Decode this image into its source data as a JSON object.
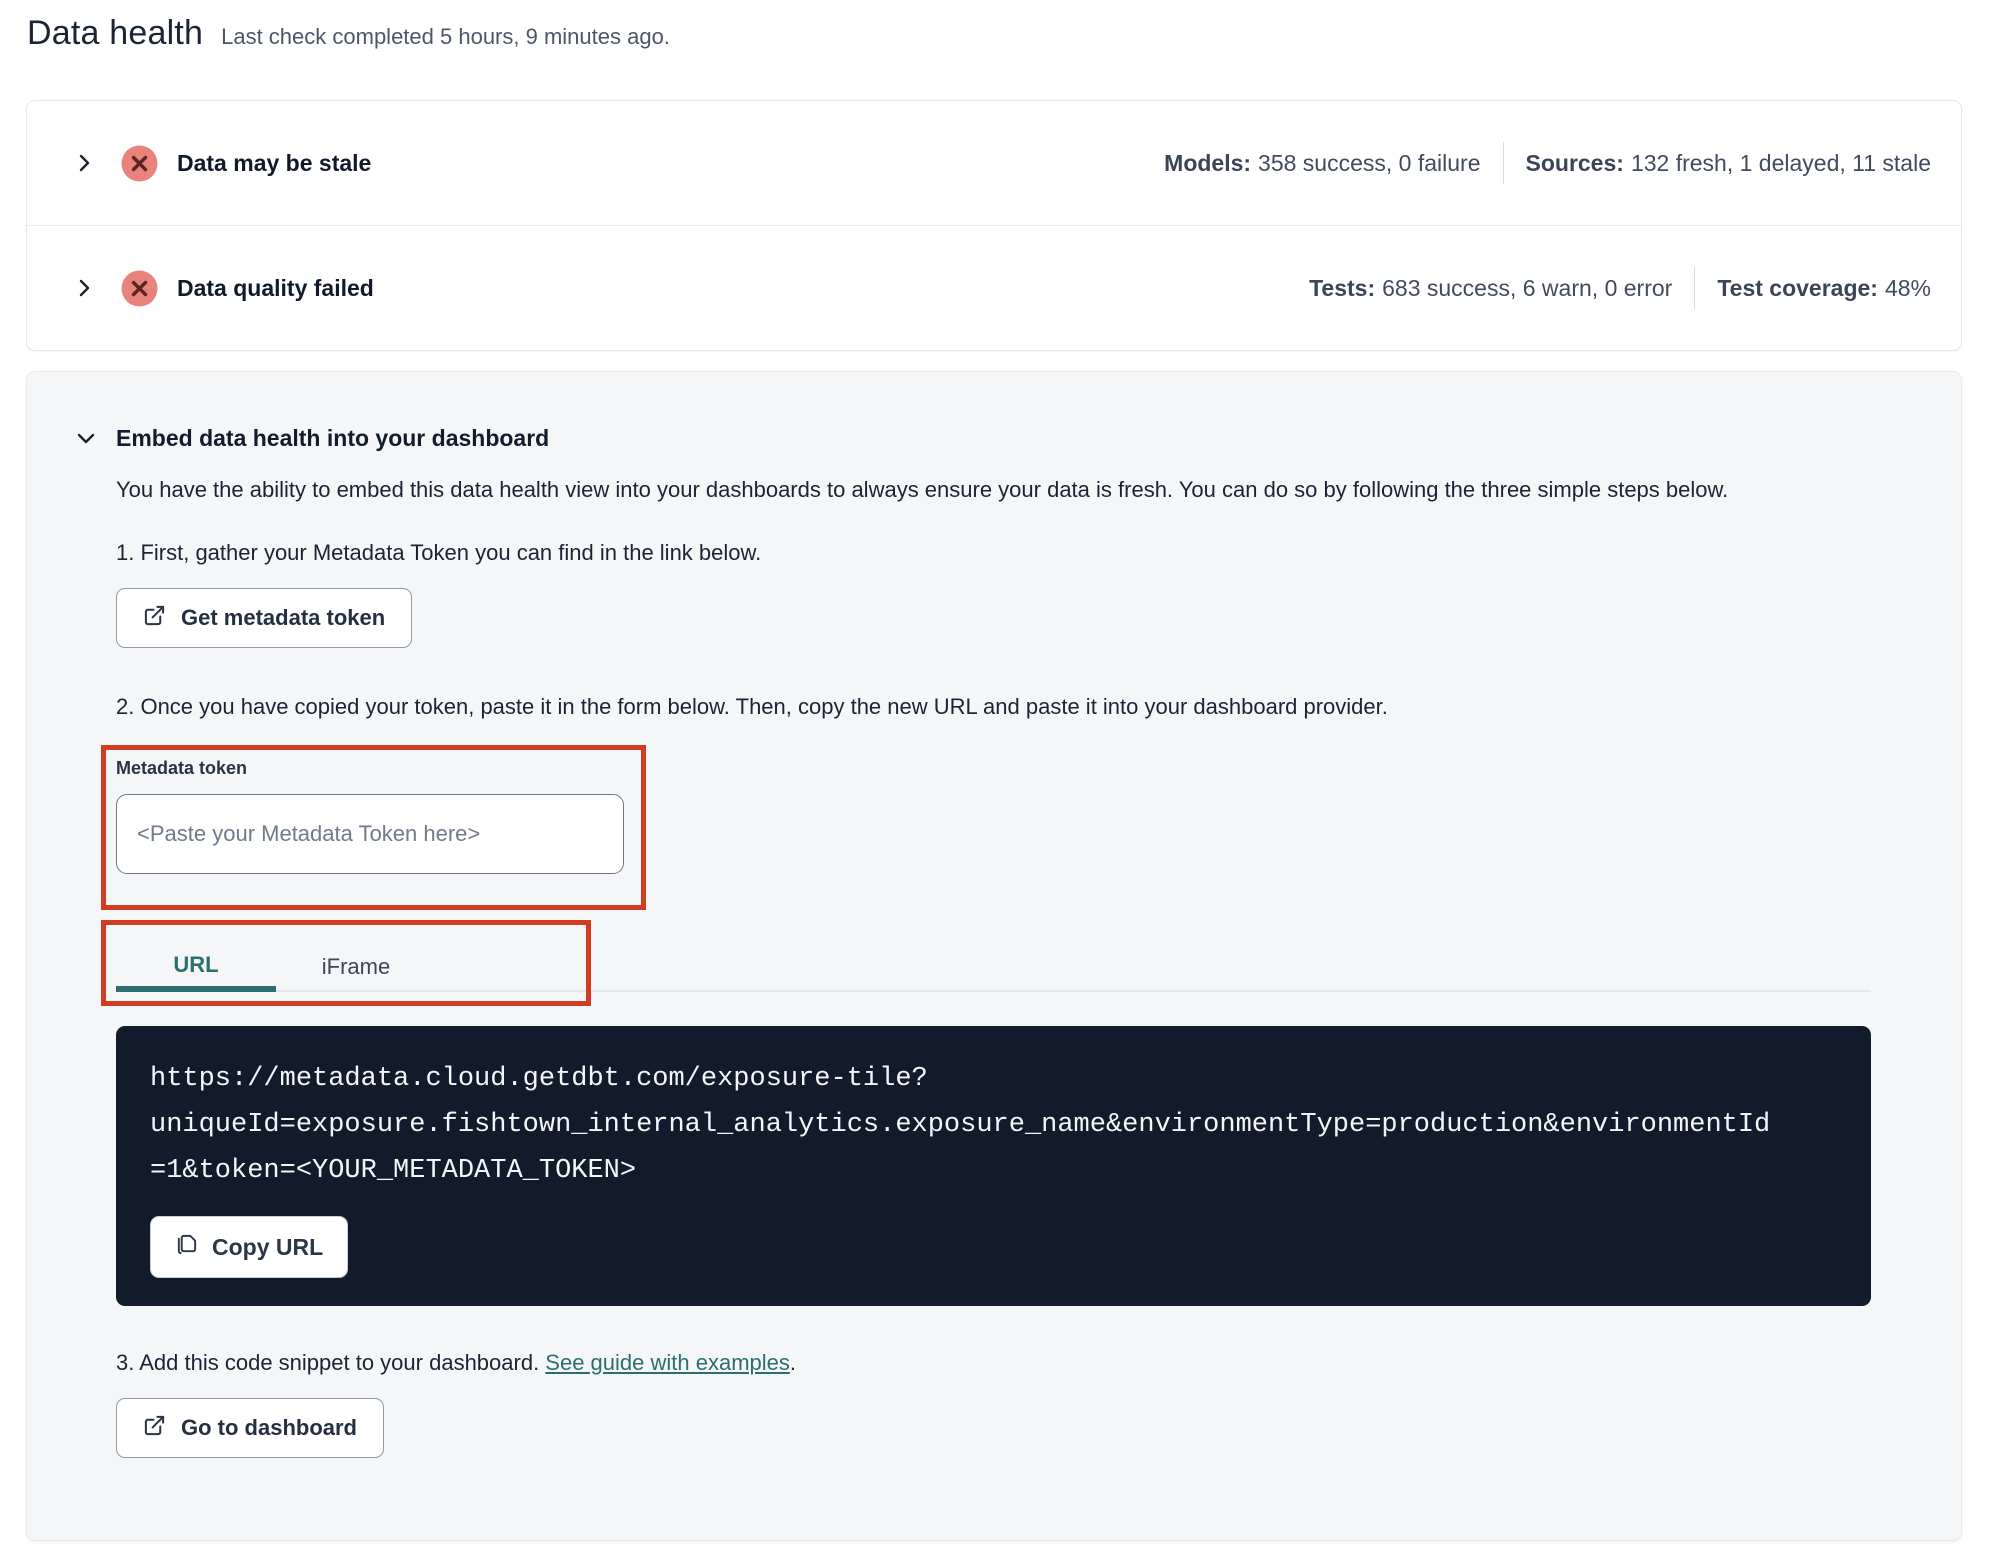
{
  "page": {
    "title": "Data health",
    "subtitle": "Last check completed 5 hours, 9 minutes ago."
  },
  "status_rows": [
    {
      "title": "Data may be stale",
      "status_icon": "error-x-circle",
      "stats": [
        {
          "label": "Models:",
          "value": "358 success, 0 failure"
        },
        {
          "label": "Sources:",
          "value": "132 fresh, 1 delayed, 11 stale"
        }
      ]
    },
    {
      "title": "Data quality failed",
      "status_icon": "error-x-circle",
      "stats": [
        {
          "label": "Tests:",
          "value": "683 success, 6 warn, 0 error"
        },
        {
          "label": "Test coverage:",
          "value": "48%"
        }
      ]
    }
  ],
  "embed": {
    "title": "Embed data health into your dashboard",
    "description": "You have the ability to embed this data health view into your dashboards to always ensure your data is fresh. You can do so by following the three simple steps below.",
    "step1": {
      "text": "1. First, gather your Metadata Token you can find in the link below.",
      "button_label": "Get metadata token",
      "button_icon": "external-link-icon"
    },
    "step2": {
      "text": "2. Once you have copied your token, paste it in the form below. Then, copy the new URL and paste it into your dashboard provider.",
      "token_label": "Metadata token",
      "token_placeholder": "<Paste your Metadata Token here>",
      "token_value": "",
      "tabs": [
        {
          "label": "URL",
          "active": true
        },
        {
          "label": "iFrame",
          "active": false
        }
      ],
      "url": "https://metadata.cloud.getdbt.com/exposure-tile?uniqueId=exposure.fishtown_internal_analytics.exposure_name&environmentType=production&environmentId=1&token=<YOUR_METADATA_TOKEN>",
      "url_lines": [
        "https://metadata.cloud.getdbt.com/exposure-tile?",
        "uniqueId=exposure.fishtown_internal_analytics.exposure_name&environmentType=production&environmentId",
        "=1&token=<YOUR_METADATA_TOKEN>"
      ],
      "copy_button_label": "Copy URL",
      "copy_button_icon": "copy-icon"
    },
    "step3": {
      "text": "3. Add this code snippet to your dashboard. ",
      "link_text": "See guide with examples",
      "suffix": ".",
      "button_label": "Go to dashboard",
      "button_icon": "external-link-icon"
    }
  },
  "colors": {
    "accent_teal": "#2d6f6e",
    "error_icon_bg": "#e8837d",
    "error_icon_x": "#5d2422",
    "annotation_red": "#d23c20",
    "code_block_bg": "#121b2b"
  }
}
